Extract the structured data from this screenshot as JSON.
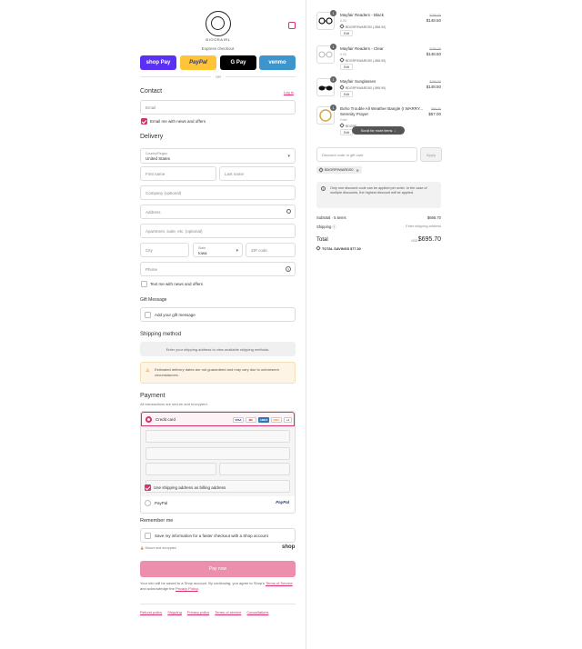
{
  "brand": {
    "logo_text": "BIOGRAIRL"
  },
  "express": {
    "label": "Express checkout",
    "shop_pay": "shop Pay",
    "paypal": "PayPal",
    "gpay": "G Pay",
    "venmo": "venmo",
    "or": "OR"
  },
  "contact": {
    "heading": "Contact",
    "login_link": "Log in",
    "email_placeholder": "Email",
    "email_news_label": "Email me with news and offers"
  },
  "delivery": {
    "heading": "Delivery",
    "country_label": "Country/Region",
    "country_value": "United States",
    "first_name": "First name",
    "last_name": "Last name",
    "company": "Company (optional)",
    "address": "Address",
    "apartment": "Apartment, suite, etc. (optional)",
    "city": "City",
    "state_label": "State",
    "state_value": "Iowa",
    "zip": "ZIP code",
    "phone": "Phone",
    "text_offers": "Text me with news and offers"
  },
  "gift": {
    "heading": "Gift Message",
    "add_label": "Add your gift message"
  },
  "shipping": {
    "heading": "Shipping method",
    "placeholder": "Enter your shipping address to view available shipping methods.",
    "notice": "Estimated delivery dates are not guaranteed and may vary due to unforeseen circumstances."
  },
  "payment": {
    "heading": "Payment",
    "subtext": "All transactions are secure and encrypted.",
    "credit_card": "Credit card",
    "card_brands": [
      "VISA",
      "MC",
      "AMEX",
      "DISC"
    ],
    "more_brands": "+4",
    "billing_label": "Use shipping address as billing address",
    "paypal_label": "PayPal",
    "paypal_logo": "PayPal"
  },
  "remember": {
    "heading": "Remember me",
    "save_label": "Save my information for a faster checkout with a Shop account",
    "secure": "Secure and encrypted",
    "shop": "shop"
  },
  "pay_now": "Pay now",
  "legal": {
    "text_a": "Your info will be saved to a Shop account. By continuing, you agree to Shop's",
    "terms_link": "Terms of Service",
    "text_b": "and acknowledge the",
    "privacy_link": "Privacy Policy",
    "text_c": "."
  },
  "footer": [
    "Refund policy",
    "Shipping",
    "Privacy policy",
    "Terms of service",
    "Cancellations"
  ],
  "cart": {
    "items": [
      {
        "qty": "1",
        "name": "Mayfair Readers - Black",
        "sub": "0.00",
        "discount": "BDGRF9WARDS0 (-$98.90)",
        "edit": "Edit",
        "old": "$180.00",
        "price": "$148.50"
      },
      {
        "qty": "1",
        "name": "Mayfair Readers - Clear",
        "sub": "0.00",
        "discount": "BDGRF9WARDS0 (-$98.90)",
        "edit": "Edit",
        "old": "$180.00",
        "price": "$148.50"
      },
      {
        "qty": "1",
        "name": "Mayfair Sunglasses",
        "sub": "",
        "discount": "BDGRF9WARDS0 (-$98.90)",
        "edit": "Edit",
        "old": "$180.00",
        "price": "$148.50"
      },
      {
        "qty": "1",
        "name": "Boho Trouble All Weather Bangle (I WARRY... Serenity Prayer",
        "sub": "Gold",
        "discount": "BDGRF...",
        "edit": "Edit",
        "old": "$95.00",
        "price": "$57.00"
      }
    ],
    "scroll_hint": "Scroll for more items",
    "discount_placeholder": "Discount code or gift card",
    "apply": "Apply",
    "applied_code": "BDGRF9WARDS0",
    "notice": "Only one discount code can be applied per order. In the case of multiple discounts, the highest discount will be applied.",
    "subtotal_label": "Subtotal · 5 items",
    "subtotal_value": "$695.70",
    "shipping_label": "Shipping",
    "shipping_value": "Enter shipping address",
    "total_label": "Total",
    "currency": "USD",
    "total_value": "$695.70",
    "savings_label": "TOTAL SAVINGS",
    "savings_value": "$77.30"
  }
}
